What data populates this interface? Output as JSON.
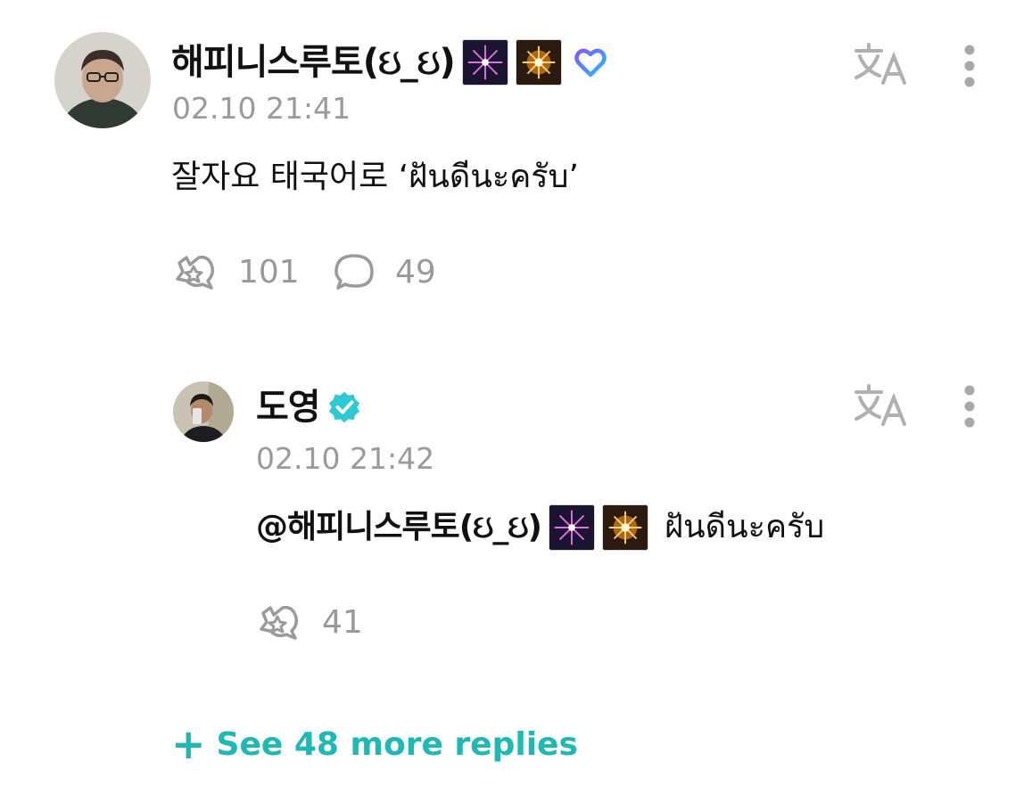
{
  "comment": {
    "username": "해피니스루토(ઇ_ઇ)",
    "timestamp": "02.10 21:41",
    "text": "잘자요 태국어로 ‘ฝันดีนะครับ’",
    "like_count": "101",
    "reply_count": "49",
    "badges": [
      "fireworks-emoji",
      "sparkler-emoji",
      "heart-badge-icon"
    ]
  },
  "reply": {
    "username": "도영",
    "verified": true,
    "timestamp": "02.10 21:42",
    "mention": "@해피니스루토(ઇ_ઇ)",
    "text": "ฝันดีนะครับ",
    "like_count": "41"
  },
  "footer": {
    "see_more_label": "See 48 more replies"
  },
  "colors": {
    "accent": "#1fb8b3",
    "verified": "#2ec9d3",
    "muted": "#999999"
  },
  "icons": [
    "translate-icon",
    "more-icon",
    "like-icon",
    "reply-icon",
    "verified-icon",
    "plus-icon"
  ]
}
